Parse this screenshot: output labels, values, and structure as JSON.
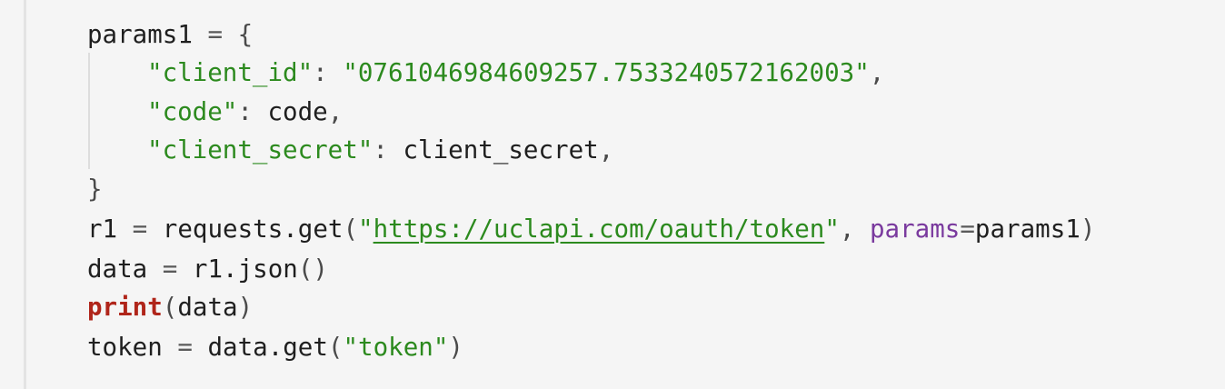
{
  "code": {
    "l1": {
      "var": "params1",
      "op": " = ",
      "brace": "{"
    },
    "l2": {
      "q1": "\"",
      "key": "client_id",
      "q2": "\"",
      "colon": ": ",
      "q3": "\"",
      "value": "0761046984609257.7533240572162003",
      "q4": "\"",
      "comma": ","
    },
    "l3": {
      "q1": "\"",
      "key": "code",
      "q2": "\"",
      "colon": ": ",
      "value": "code",
      "comma": ","
    },
    "l4": {
      "q1": "\"",
      "key": "client_secret",
      "q2": "\"",
      "colon": ": ",
      "value": "client_secret",
      "comma": ","
    },
    "l5": {
      "brace": "}"
    },
    "l6": {
      "var": "r1",
      "op": " = ",
      "call": "requests.get",
      "paren_open": "(",
      "q1": "\"",
      "url": "https://uclapi.com/oauth/token",
      "q2": "\"",
      "comma": ", ",
      "kwarg": "params",
      "eq": "=",
      "arg": "params1",
      "paren_close": ")"
    },
    "l7": {
      "var": "data",
      "op": " = ",
      "call": "r1.json",
      "parens": "()"
    },
    "l8": {
      "kw": "print",
      "paren_open": "(",
      "arg": "data",
      "paren_close": ")"
    },
    "l9": {
      "var": "token",
      "op": " = ",
      "call": "data.get",
      "paren_open": "(",
      "q1": "\"",
      "str": "token",
      "q2": "\"",
      "paren_close": ")"
    }
  },
  "colors": {
    "background": "#f5f5f5",
    "string": "#2c8a1e",
    "keyword": "#b0251a",
    "kwarg": "#7a3a9e",
    "text": "#1f1f1f"
  }
}
